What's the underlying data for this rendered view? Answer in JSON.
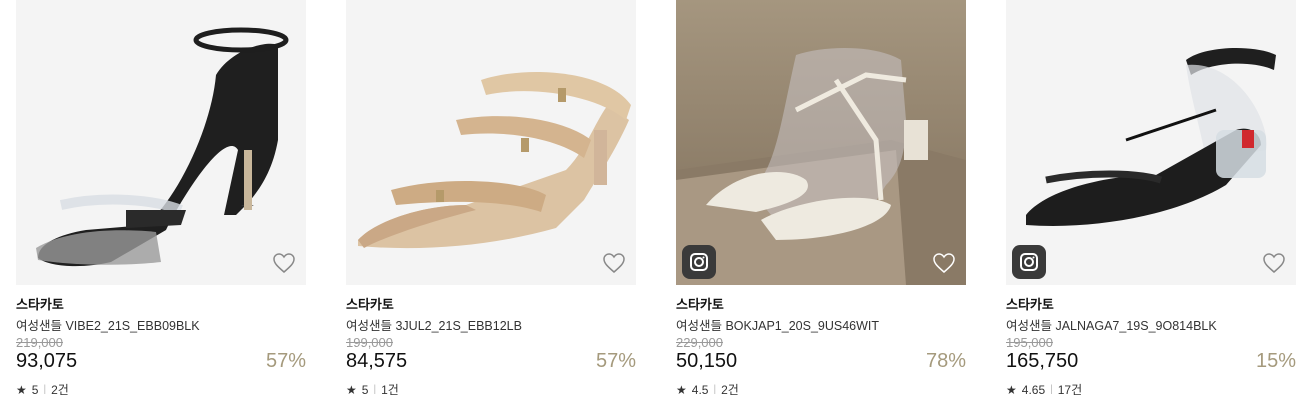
{
  "products": [
    {
      "brand": "스타카토",
      "name": "여성샌들 VIBE2_21S_EBB09BLK",
      "original_price": "219,000",
      "price": "93,075",
      "discount": "57%",
      "rating": "5",
      "reviews": "2건",
      "has_instagram_badge": false,
      "star_icon": "★"
    },
    {
      "brand": "스타카토",
      "name": "여성샌들 3JUL2_21S_EBB12LB",
      "original_price": "199,000",
      "price": "84,575",
      "discount": "57%",
      "rating": "5",
      "reviews": "1건",
      "has_instagram_badge": false,
      "star_icon": "★"
    },
    {
      "brand": "스타카토",
      "name": "여성샌들 BOKJAP1_20S_9US46WIT",
      "original_price": "229,000",
      "price": "50,150",
      "discount": "78%",
      "rating": "4.5",
      "reviews": "2건",
      "has_instagram_badge": true,
      "star_icon": "★"
    },
    {
      "brand": "스타카토",
      "name": "여성샌들 JALNAGA7_19S_9O814BLK",
      "original_price": "195,000",
      "price": "165,750",
      "discount": "15%",
      "rating": "4.65",
      "reviews": "17건",
      "has_instagram_badge": true,
      "star_icon": "★"
    }
  ],
  "colors": {
    "discount": "#a59a7d",
    "strike": "#9a9a9a"
  },
  "icons": {
    "wishlist": "heart-icon",
    "badge": "instagram-icon",
    "rating": "star-icon"
  }
}
